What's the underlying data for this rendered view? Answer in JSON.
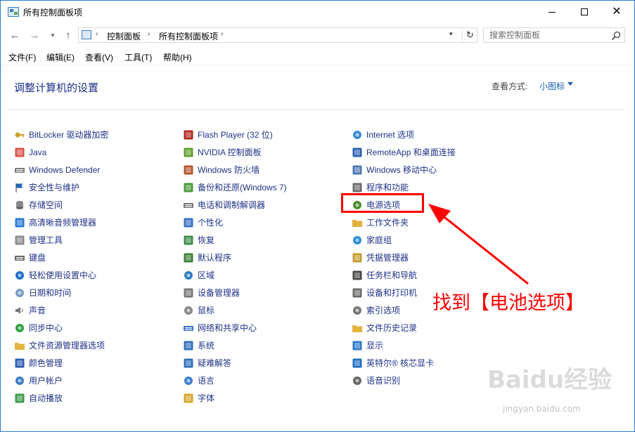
{
  "window": {
    "title": "所有控制面板项"
  },
  "navigation": {
    "back_glyph": "←",
    "forward_glyph": "→",
    "up_glyph": "↑",
    "refresh_glyph": "↻",
    "breadcrumbs": [
      "控制面板",
      "所有控制面板项"
    ],
    "search_placeholder": "搜索控制面板"
  },
  "menu": [
    "文件(F)",
    "编辑(E)",
    "查看(V)",
    "工具(T)",
    "帮助(H)"
  ],
  "header": {
    "title": "调整计算机的设置",
    "view_by_label": "查看方式:",
    "view_by_value": "小图标"
  },
  "columns": [
    [
      {
        "label": "BitLocker 驱动器加密",
        "icon": "bitlocker-icon"
      },
      {
        "label": "Java",
        "icon": "java-icon"
      },
      {
        "label": "Windows Defender",
        "icon": "defender-icon"
      },
      {
        "label": "安全性与维护",
        "icon": "flag-icon"
      },
      {
        "label": "存储空间",
        "icon": "storage-icon"
      },
      {
        "label": "高清晰音频管理器",
        "icon": "audio-manager-icon"
      },
      {
        "label": "管理工具",
        "icon": "admin-tools-icon"
      },
      {
        "label": "键盘",
        "icon": "keyboard-icon"
      },
      {
        "label": "轻松使用设置中心",
        "icon": "ease-of-access-icon"
      },
      {
        "label": "日期和时间",
        "icon": "clock-icon"
      },
      {
        "label": "声音",
        "icon": "speaker-icon"
      },
      {
        "label": "同步中心",
        "icon": "sync-icon"
      },
      {
        "label": "文件资源管理器选项",
        "icon": "folder-options-icon"
      },
      {
        "label": "颜色管理",
        "icon": "color-management-icon"
      },
      {
        "label": "用户帐户",
        "icon": "users-icon"
      },
      {
        "label": "自动播放",
        "icon": "autoplay-icon"
      }
    ],
    [
      {
        "label": "Flash Player (32 位)",
        "icon": "flash-icon"
      },
      {
        "label": "NVIDIA 控制面板",
        "icon": "nvidia-icon"
      },
      {
        "label": "Windows 防火墙",
        "icon": "firewall-icon"
      },
      {
        "label": "备份和还原(Windows 7)",
        "icon": "backup-icon"
      },
      {
        "label": "电话和调制解调器",
        "icon": "modem-icon"
      },
      {
        "label": "个性化",
        "icon": "personalization-icon"
      },
      {
        "label": "恢复",
        "icon": "recovery-icon"
      },
      {
        "label": "默认程序",
        "icon": "default-programs-icon"
      },
      {
        "label": "区域",
        "icon": "globe-icon"
      },
      {
        "label": "设备管理器",
        "icon": "device-manager-icon"
      },
      {
        "label": "鼠标",
        "icon": "mouse-icon"
      },
      {
        "label": "网络和共享中心",
        "icon": "network-icon"
      },
      {
        "label": "系统",
        "icon": "system-icon"
      },
      {
        "label": "疑难解答",
        "icon": "troubleshoot-icon"
      },
      {
        "label": "语言",
        "icon": "language-icon"
      },
      {
        "label": "字体",
        "icon": "fonts-icon"
      }
    ],
    [
      {
        "label": "Internet 选项",
        "icon": "internet-icon"
      },
      {
        "label": "RemoteApp 和桌面连接",
        "icon": "remoteapp-icon"
      },
      {
        "label": "Windows 移动中心",
        "icon": "mobility-center-icon"
      },
      {
        "label": "程序和功能",
        "icon": "programs-icon"
      },
      {
        "label": "电源选项",
        "icon": "power-options-icon"
      },
      {
        "label": "工作文件夹",
        "icon": "work-folders-icon"
      },
      {
        "label": "家庭组",
        "icon": "homegroup-icon"
      },
      {
        "label": "凭据管理器",
        "icon": "credential-icon"
      },
      {
        "label": "任务栏和导航",
        "icon": "taskbar-icon"
      },
      {
        "label": "设备和打印机",
        "icon": "printer-icon"
      },
      {
        "label": "索引选项",
        "icon": "indexing-icon"
      },
      {
        "label": "文件历史记录",
        "icon": "file-history-icon"
      },
      {
        "label": "显示",
        "icon": "display-icon"
      },
      {
        "label": "英特尔® 核芯显卡",
        "icon": "intel-graphics-icon"
      },
      {
        "label": "语音识别",
        "icon": "microphone-icon"
      }
    ]
  ],
  "annotation": {
    "text": "找到【电池选项】"
  },
  "watermark": {
    "text": "Baidu经验",
    "sub": "jingyan.baidu.com"
  },
  "colors": {
    "link": "#1e3287",
    "accent": "#1a5fb4",
    "annotation": "#ff0000",
    "window_border": "#2b7bd6"
  }
}
